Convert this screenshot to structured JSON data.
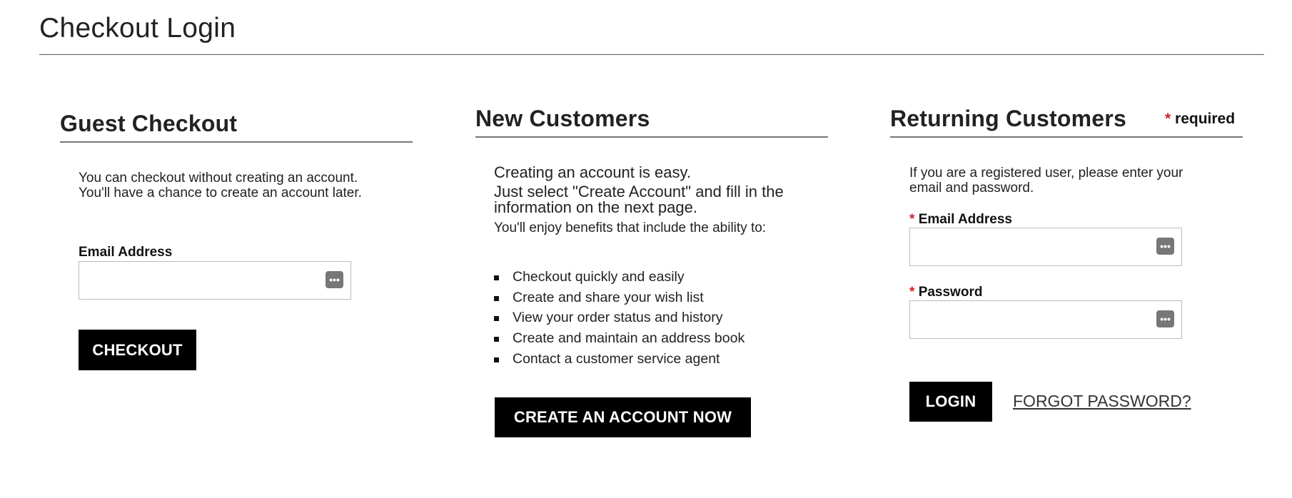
{
  "page": {
    "title": "Checkout Login"
  },
  "guest": {
    "heading": "Guest Checkout",
    "description": "You can checkout without creating an account. You'll have a chance to create an account later.",
    "email_label": "Email Address",
    "email_value": "",
    "checkout_button": "CHECKOUT",
    "field_icon": "password-manager-icon"
  },
  "new_customers": {
    "heading": "New Customers",
    "line1": "Creating an account is easy.",
    "line2": "Just select \"Create Account\" and fill in the information on the next page.",
    "line3": "You'll enjoy benefits that include the ability to:",
    "benefits": [
      "Checkout quickly and easily",
      "Create and share your wish list",
      "View your order status and history",
      "Create and maintain an address book",
      "Contact a customer service agent"
    ],
    "create_button": "CREATE AN ACCOUNT NOW"
  },
  "returning": {
    "heading": "Returning Customers",
    "required_star": "*",
    "required_text": "required",
    "description": "If you are a registered user, please enter your email and password.",
    "email_label": "Email Address",
    "email_value": "",
    "password_label": "Password",
    "password_value": "",
    "login_button": "LOGIN",
    "forgot_link": "FORGOT PASSWORD?",
    "field_icon": "password-manager-icon"
  },
  "colors": {
    "required": "#d21f2a",
    "button_bg": "#000000",
    "button_text": "#ffffff"
  }
}
